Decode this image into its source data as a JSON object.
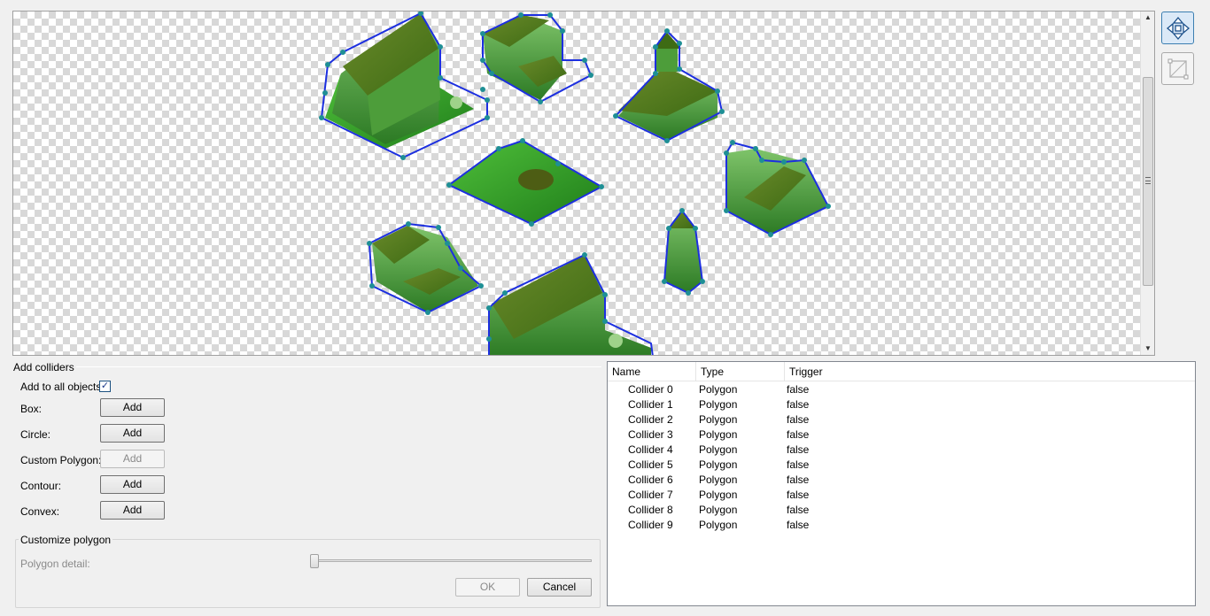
{
  "viewport": {
    "scroll_up_glyph": "▲",
    "scroll_down_glyph": "▼"
  },
  "tools": [
    {
      "name": "move-points-icon",
      "active": true
    },
    {
      "name": "select-rect-icon",
      "active": false
    }
  ],
  "colors": {
    "collider_outline": "#1c2fe0",
    "vertex": "#1e8f95",
    "sprite_green": "#2f8a1e",
    "checker_dark": "#d8d8d8"
  },
  "add_colliders": {
    "title": "Add colliders",
    "add_to_all_label": "Add to all objects",
    "add_to_all_checked": true,
    "check_glyph": "✓",
    "rows": [
      {
        "label": "Box:",
        "button": "Add",
        "enabled": true
      },
      {
        "label": "Circle:",
        "button": "Add",
        "enabled": true
      },
      {
        "label": "Custom Polygon:",
        "button": "Add",
        "enabled": false
      },
      {
        "label": "Contour:",
        "button": "Add",
        "enabled": true
      },
      {
        "label": "Convex:",
        "button": "Add",
        "enabled": true
      }
    ]
  },
  "customize_polygon": {
    "title": "Customize polygon",
    "detail_label": "Polygon detail:",
    "detail_value": 0,
    "ok_label": "OK",
    "cancel_label": "Cancel"
  },
  "colliders_table": {
    "columns": [
      "Name",
      "Type",
      "Trigger"
    ],
    "rows": [
      {
        "name": "Collider 0",
        "type": "Polygon",
        "trigger": "false"
      },
      {
        "name": "Collider 1",
        "type": "Polygon",
        "trigger": "false"
      },
      {
        "name": "Collider 2",
        "type": "Polygon",
        "trigger": "false"
      },
      {
        "name": "Collider 3",
        "type": "Polygon",
        "trigger": "false"
      },
      {
        "name": "Collider 4",
        "type": "Polygon",
        "trigger": "false"
      },
      {
        "name": "Collider 5",
        "type": "Polygon",
        "trigger": "false"
      },
      {
        "name": "Collider 6",
        "type": "Polygon",
        "trigger": "false"
      },
      {
        "name": "Collider 7",
        "type": "Polygon",
        "trigger": "false"
      },
      {
        "name": "Collider 8",
        "type": "Polygon",
        "trigger": "false"
      },
      {
        "name": "Collider 9",
        "type": "Polygon",
        "trigger": "false"
      }
    ]
  }
}
